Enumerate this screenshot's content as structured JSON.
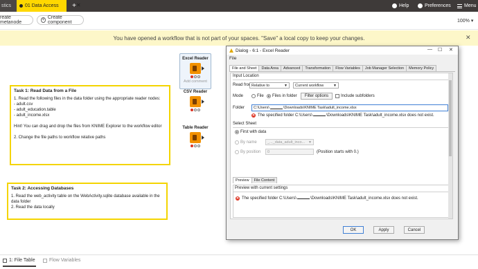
{
  "tabs": {
    "prev_label": "stics",
    "active_label": "01 Data Access",
    "close_glyph": "✕",
    "add_glyph": "+"
  },
  "top_right": {
    "help": "Help",
    "preferences": "Preferences",
    "menu": "Menu"
  },
  "toolbar": {
    "metanode": "reate metanode",
    "component": "Create component",
    "zoom": "100%",
    "zoom_chevron": "▾"
  },
  "banner": {
    "text": "You have opened a workflow that is not part of your spaces. \"Save\" a local copy to keep your changes.",
    "close_glyph": "✕"
  },
  "annotations": [
    {
      "title": "Task 1: Read Data from a File",
      "body": "1. Read the following files in the data folder using the appropriate reader nodes:\n- adult.csv\n- adult_education.table\n- adult_income.xlsx\n\nHint! You can drag and drop the files from KNIME Explorer to the workflow editor\n\n2. Change the file paths to workflow relative paths"
    },
    {
      "title": "Task 2: Accessing Databases",
      "body": "1. Read the web_activity table on the WebActivity.sqlite database available in the data folder\n2. Read the data locally"
    }
  ],
  "nodes": {
    "excel": {
      "label": "Excel Reader",
      "add_comment": "Add comment"
    },
    "csv": {
      "label": "CSV Reader"
    },
    "table": {
      "label": "Table Reader"
    }
  },
  "dialog": {
    "title": "Dialog - 6:1 - Excel Reader",
    "minimize": "—",
    "maximize": "☐",
    "close": "✕",
    "menu_file": "File",
    "tabs": [
      "File and Sheet",
      "Data Area",
      "Advanced",
      "Transformation",
      "Flow Variables",
      "Job Manager Selection",
      "Memory Policy"
    ],
    "input_location": {
      "section": "Input Location",
      "read_from_label": "Read from",
      "read_from_value": "Relative to",
      "workflow_value": "Current workflow",
      "mode_label": "Mode",
      "mode_file": "File",
      "mode_files_in_folder": "Files in folder",
      "filter_options": "Filter options",
      "include_subfolders": "Include subfolders",
      "folder_label": "Folder",
      "folder_prefix": "C:\\Users\\",
      "folder_suffix": "\\Downloads\\KNIME Task\\adult_income.xlsx",
      "error_prefix": "The specified folder C:\\Users\\",
      "error_suffix": "\\Downloads\\KNIME Task\\adult_income.xlsx does not exist."
    },
    "select_sheet": {
      "section": "Select Sheet",
      "first_with_data": "First with data",
      "by_name": "By name",
      "by_name_value": "_..._data_adult_inco...",
      "by_position": "By position",
      "by_position_value": "0",
      "position_hint": "(Position starts with 0.)"
    },
    "preview": {
      "tab_preview": "Preview",
      "tab_file_content": "File Content",
      "header": "Preview with current settings",
      "error_prefix": "The specified folder C:\\Users\\",
      "error_suffix": "\\Downloads\\KNIME Task\\adult_income.xlsx does not exist."
    },
    "buttons": {
      "ok": "OK",
      "apply": "Apply",
      "cancel": "Cancel"
    }
  },
  "bottom": {
    "file_table": "1: File Table",
    "flow_variables": "Flow Variables"
  },
  "colors": {
    "accent": "#ffd800",
    "topbar": "#3e3a39",
    "banner": "#fdf7c9",
    "node_orange": "#f29100",
    "error_red": "#dd3322"
  }
}
